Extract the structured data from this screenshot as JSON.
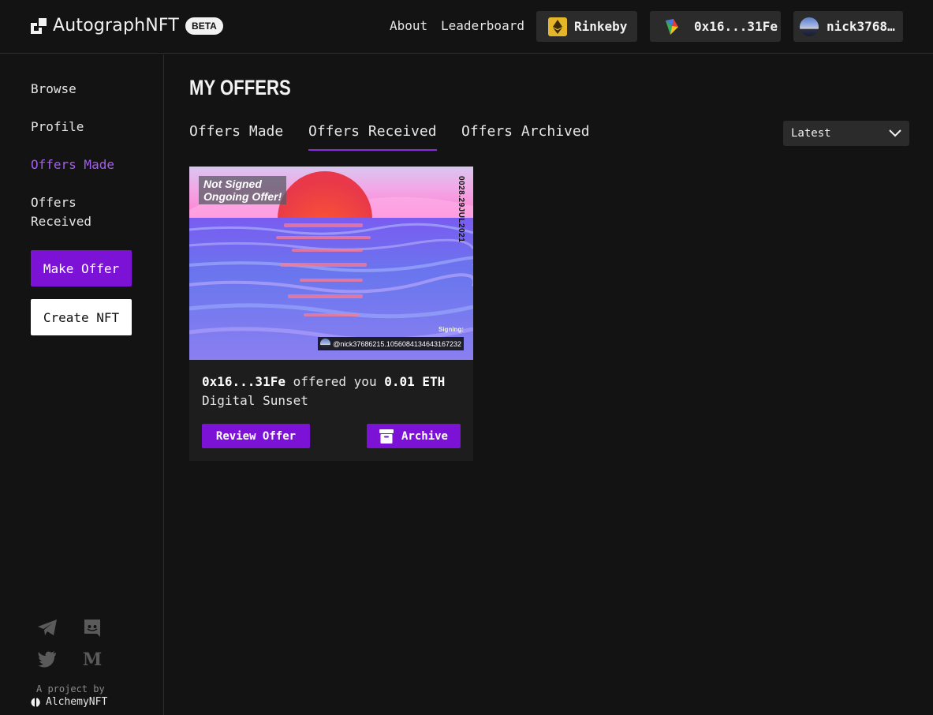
{
  "header": {
    "app_title": "AutographNFT",
    "beta_badge": "BETA",
    "nav": {
      "about": "About",
      "leaderboard": "Leaderboard"
    },
    "network": {
      "label": "Rinkeby",
      "icon": "ethereum-icon"
    },
    "wallet": {
      "address": "0x16...31Fe",
      "icon": "wallet-icon"
    },
    "user": {
      "handle": "nick3768…"
    }
  },
  "sidebar": {
    "items": [
      {
        "label": "Browse"
      },
      {
        "label": "Profile"
      },
      {
        "label": "Offers Made",
        "active": true
      },
      {
        "label": "Offers Received"
      }
    ],
    "make_offer": "Make Offer",
    "create_nft": "Create NFT",
    "social_icons": [
      "telegram-icon",
      "discord-icon",
      "twitter-icon",
      "medium-icon"
    ],
    "footer": {
      "project_by": "A project by",
      "brand": "AlchemyNFT"
    }
  },
  "main": {
    "title": "MY OFFERS",
    "tabs": [
      {
        "label": "Offers Made",
        "active": false
      },
      {
        "label": "Offers Received",
        "active": true
      },
      {
        "label": "Offers Archived",
        "active": false
      }
    ],
    "sort": {
      "selected": "Latest"
    },
    "offers": [
      {
        "image_label_line1": "Not Signed",
        "image_label_line2": "Ongoing Offer!",
        "image_date": "0028.29JUL2021",
        "signing_label": "Signing:",
        "signer": "@nick37686215.1056084134643167232",
        "from": "0x16...31Fe",
        "offered_text": "offered you",
        "amount": "0.01 ETH",
        "nft_name": "Digital Sunset",
        "review_label": "Review Offer",
        "archive_label": "Archive"
      }
    ]
  },
  "colors": {
    "accent": "#7c12d6",
    "active_link": "#a35df0",
    "background": "#131313",
    "card": "#1d1d1d",
    "chip": "#2b2b2b",
    "network_badge": "#e5b62a"
  }
}
